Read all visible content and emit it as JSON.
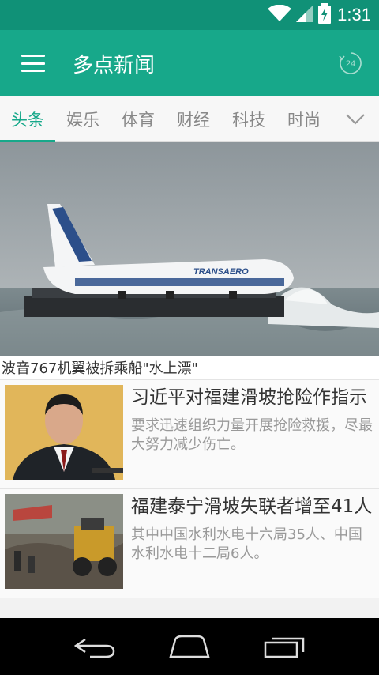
{
  "status_bar": {
    "time": "1:31",
    "icons": [
      "wifi-icon",
      "signal-icon",
      "battery-charging-icon"
    ]
  },
  "app_bar": {
    "title": "多点新闻",
    "menu_icon": "hamburger-menu-icon",
    "refresh_badge": "24",
    "accent_color": "#17a88a",
    "status_color": "#109177"
  },
  "tabs": [
    {
      "label": "头条",
      "active": true
    },
    {
      "label": "娱乐",
      "active": false
    },
    {
      "label": "体育",
      "active": false
    },
    {
      "label": "财经",
      "active": false
    },
    {
      "label": "科技",
      "active": false
    },
    {
      "label": "时尚",
      "active": false
    }
  ],
  "tab_more_icon": "chevron-down-icon",
  "hero": {
    "caption": "波音767机翼被拆乘船\"水上漂\"",
    "aircraft_livery": "TRANSAERO"
  },
  "news": [
    {
      "title": "习近平对福建滑坡抢险作指示",
      "summary": "要求迅速组织力量开展抢险救援，尽最大努力减少伤亡。"
    },
    {
      "title": "福建泰宁滑坡失联者增至41人",
      "summary": "其中中国水利水电十六局35人、中国水利水电十二局6人。"
    }
  ],
  "nav_bar": [
    "back-icon",
    "home-icon",
    "recents-icon"
  ]
}
